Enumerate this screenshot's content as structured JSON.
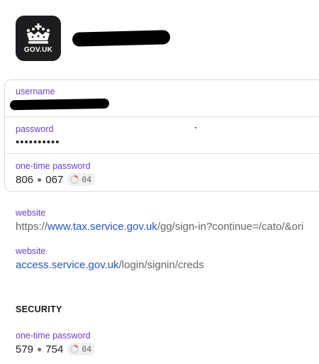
{
  "header": {
    "app_icon_text": "GOV.UK",
    "icon_name": "crown-icon"
  },
  "login": {
    "username_label": "username",
    "password_label": "password",
    "password_masked": "••••••••••",
    "otp_label": "one-time password",
    "otp_part1": "806",
    "otp_part2": "067",
    "otp_timer": "04"
  },
  "websites": [
    {
      "label": "website",
      "prefix": "https://",
      "host": "www.tax.service.gov.uk",
      "path": "/gg/sign-in?continue=/cato/&ori"
    },
    {
      "label": "website",
      "prefix": "",
      "host": "access.service.gov.uk",
      "path": "/login/signin/creds"
    }
  ],
  "security": {
    "heading": "SECURITY",
    "otp_label": "one-time password",
    "otp_part1": "579",
    "otp_part2": "754",
    "otp_timer": "04"
  },
  "colors": {
    "label": "#6b3fd4",
    "link": "#2456c8",
    "timer_arc": "#e8533f"
  }
}
